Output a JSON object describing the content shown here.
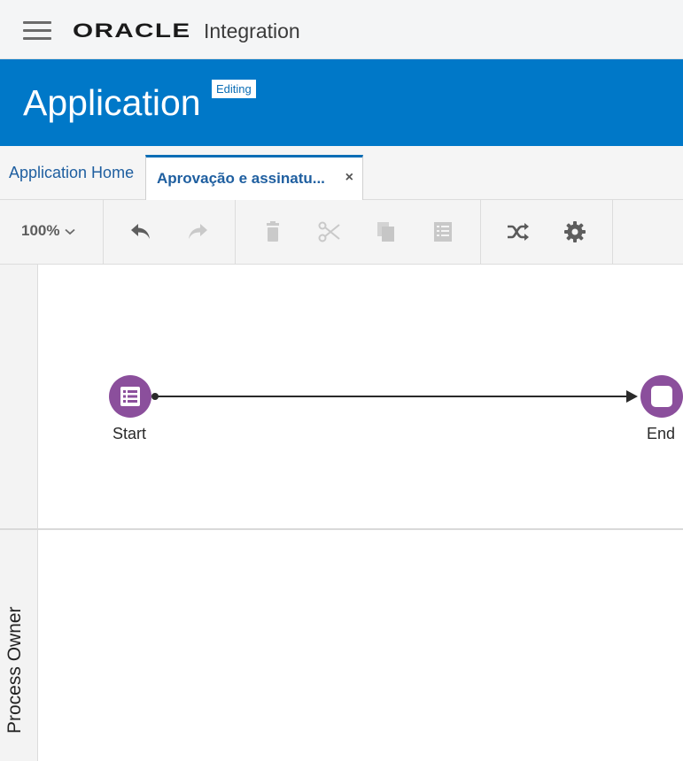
{
  "topbar": {
    "brand": "ORACLE",
    "product": "Integration"
  },
  "header": {
    "title": "Application",
    "badge": "Editing"
  },
  "tabs": [
    {
      "label": "Application Home"
    },
    {
      "label": "Aprovação e assinatu...",
      "close": "×"
    }
  ],
  "toolbar": {
    "zoom": "100%",
    "buttons": [
      "undo-icon",
      "redo-icon",
      "delete-icon",
      "cut-icon",
      "copy-icon",
      "paste-icon",
      "shuffle-icon",
      "gear-icon"
    ]
  },
  "canvas": {
    "lane_label": "Process Owner",
    "start_label": "Start",
    "end_label": "End"
  },
  "colors": {
    "header": "#0078c8",
    "node": "#8b4f9c",
    "link": "#1f5fa0"
  }
}
